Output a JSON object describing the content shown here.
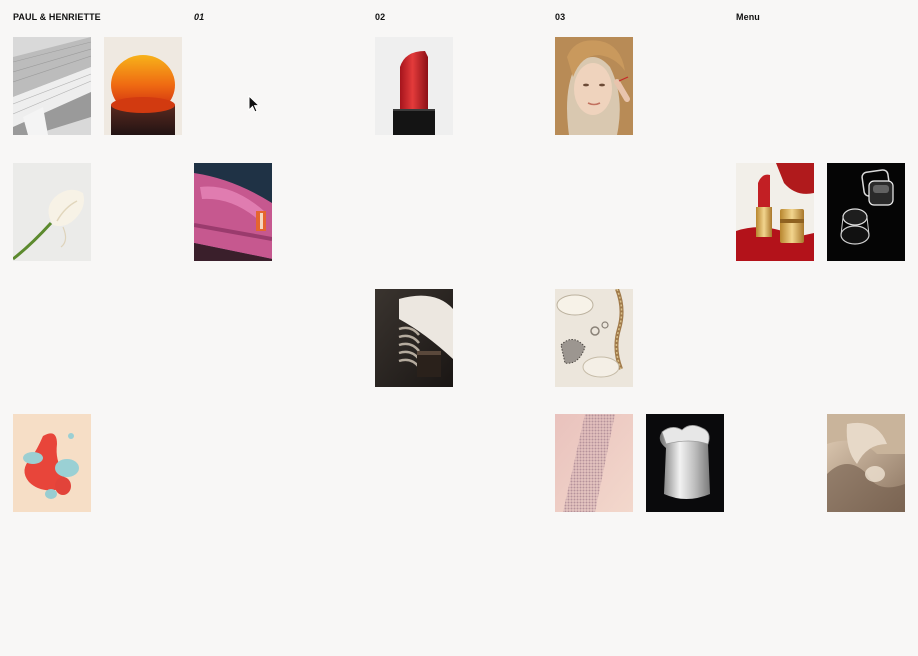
{
  "header": {
    "brand": "PAUL & HENRIETTE",
    "section_1": "01",
    "section_2": "02",
    "section_3": "03",
    "menu": "Menu"
  },
  "tiles": [
    {
      "name": "project-tile-pleated-paper"
    },
    {
      "name": "project-tile-orange-sun"
    },
    {
      "name": "project-tile-red-lipstick"
    },
    {
      "name": "project-tile-woman-portrait"
    },
    {
      "name": "project-tile-calla-lily"
    },
    {
      "name": "project-tile-pink-sandal"
    },
    {
      "name": "project-tile-lipstick-gold"
    },
    {
      "name": "project-tile-glass-cubes"
    },
    {
      "name": "project-tile-ribbed-object"
    },
    {
      "name": "project-tile-jewelry-flatlay"
    },
    {
      "name": "project-tile-color-blobs"
    },
    {
      "name": "project-tile-sequin-fabric"
    },
    {
      "name": "project-tile-aalto-vase"
    },
    {
      "name": "project-tile-folded-sculpture"
    }
  ],
  "colors": {
    "background": "#f8f7f6",
    "text": "#111111"
  }
}
